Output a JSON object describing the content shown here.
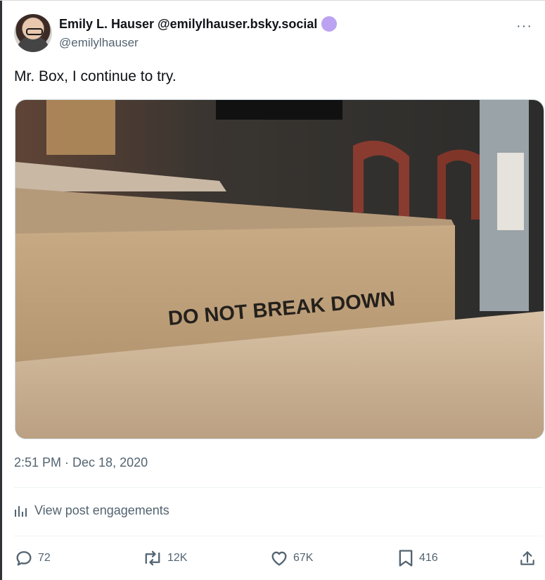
{
  "author": {
    "display_name": "Emily L. Hauser @emilylhauser.bsky.social",
    "handle": "@emilylhauser",
    "more_label": "···"
  },
  "post": {
    "text": "Mr. Box, I continue to try.",
    "image_text": "DO NOT BREAK DOWN",
    "timestamp": "2:51 PM · Dec 18, 2020"
  },
  "engagements_label": "View post engagements",
  "actions": {
    "replies": "72",
    "reposts": "12K",
    "likes": "67K",
    "bookmarks": "416"
  },
  "colors": {
    "text": "#0f1419",
    "secondary": "#536471",
    "verified_badge": "#bca3f2",
    "divider": "#eff3f4"
  },
  "icons": [
    "more-icon",
    "verified-badge-icon",
    "analytics-icon",
    "reply-icon",
    "repost-icon",
    "like-icon",
    "bookmark-icon",
    "share-icon"
  ]
}
